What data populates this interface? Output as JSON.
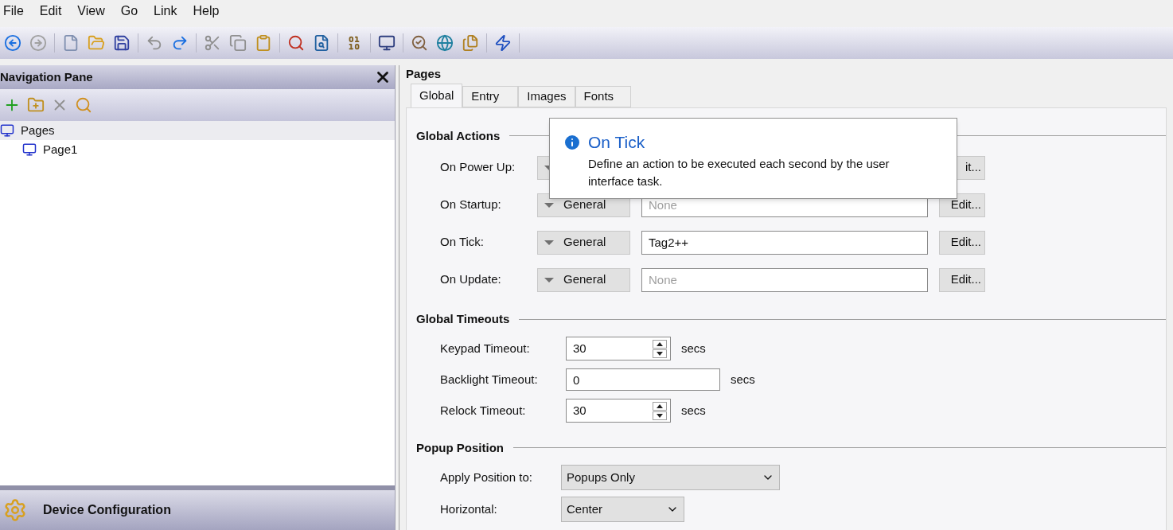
{
  "menu": [
    "File",
    "Edit",
    "View",
    "Go",
    "Link",
    "Help"
  ],
  "navigation_pane": {
    "title": "Navigation Pane",
    "tree": [
      {
        "label": "Pages",
        "selected": true,
        "children": [
          {
            "label": "Page1",
            "selected": false
          }
        ]
      }
    ],
    "footer": "Device Configuration"
  },
  "panel": {
    "title": "Pages",
    "tabs": [
      {
        "label": "Global",
        "selected": true
      },
      {
        "label": "Entry",
        "selected": false
      },
      {
        "label": "Images",
        "selected": false
      },
      {
        "label": "Fonts",
        "selected": false
      }
    ],
    "global_actions": {
      "title": "Global Actions",
      "rows": [
        {
          "label": "On Power Up:",
          "type": "",
          "value": "",
          "placeholder": "",
          "edit": "it..."
        },
        {
          "label": "On Startup:",
          "type": "General",
          "value": "",
          "placeholder": "None",
          "edit": "Edit..."
        },
        {
          "label": "On Tick:",
          "type": "General",
          "value": "Tag2++",
          "placeholder": "",
          "edit": "Edit..."
        },
        {
          "label": "On Update:",
          "type": "General",
          "value": "",
          "placeholder": "None",
          "edit": "Edit..."
        }
      ]
    },
    "global_timeouts": {
      "title": "Global Timeouts",
      "rows": [
        {
          "label": "Keypad Timeout:",
          "kind": "spin",
          "value": "30",
          "unit": "secs"
        },
        {
          "label": "Backlight Timeout:",
          "kind": "text",
          "value": "0",
          "unit": "secs"
        },
        {
          "label": "Relock Timeout:",
          "kind": "spin",
          "value": "30",
          "unit": "secs"
        }
      ]
    },
    "popup_position": {
      "title": "Popup Position",
      "rows": [
        {
          "label": "Apply Position to:",
          "value": "Popups Only",
          "kind": "wide"
        },
        {
          "label": "Horizontal:",
          "value": "Center",
          "kind": "narrow"
        }
      ]
    }
  },
  "tooltip": {
    "title": "On Tick",
    "text": "Define an action to be executed each second by the user interface task."
  }
}
